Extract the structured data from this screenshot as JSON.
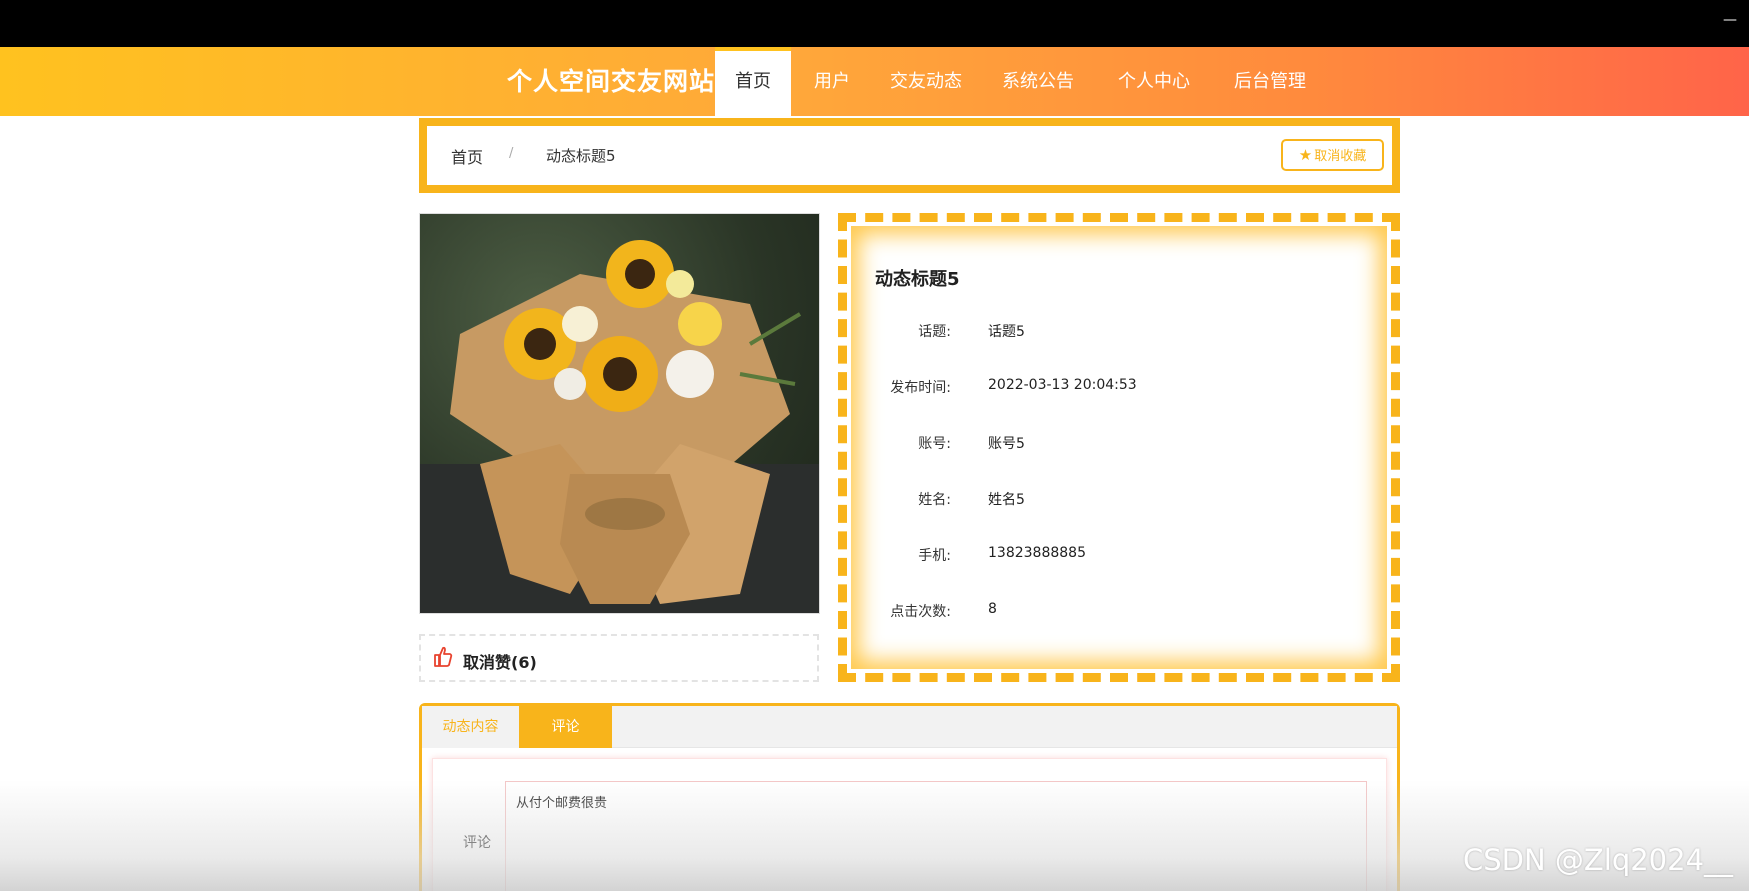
{
  "nav": {
    "brand": "个人空间交友网站",
    "items": [
      "首页",
      "用户",
      "交友动态",
      "系统公告",
      "个人中心",
      "后台管理"
    ],
    "active_index": 0
  },
  "breadcrumb": {
    "home": "首页",
    "separator": "/",
    "current": "动态标题5",
    "fav_button": "取消收藏"
  },
  "like": {
    "label": "取消赞(6)"
  },
  "detail": {
    "title": "动态标题5",
    "rows": [
      {
        "label": "话题:",
        "value": "话题5"
      },
      {
        "label": "发布时间:",
        "value": "2022-03-13 20:04:53"
      },
      {
        "label": "账号:",
        "value": "账号5"
      },
      {
        "label": "姓名:",
        "value": "姓名5"
      },
      {
        "label": "手机:",
        "value": "13823888885"
      },
      {
        "label": "点击次数:",
        "value": "8"
      }
    ]
  },
  "tabs": {
    "items": [
      "动态内容",
      "评论"
    ],
    "active_index": 1
  },
  "comment": {
    "label": "评论",
    "value": "从付个邮费很贵"
  },
  "watermark": "CSDN @Zlq2024__",
  "window": {
    "minimize": "—"
  },
  "colors": {
    "accent": "#f8b41b",
    "nav_start": "#ffc21f",
    "nav_end": "#ff6449"
  }
}
